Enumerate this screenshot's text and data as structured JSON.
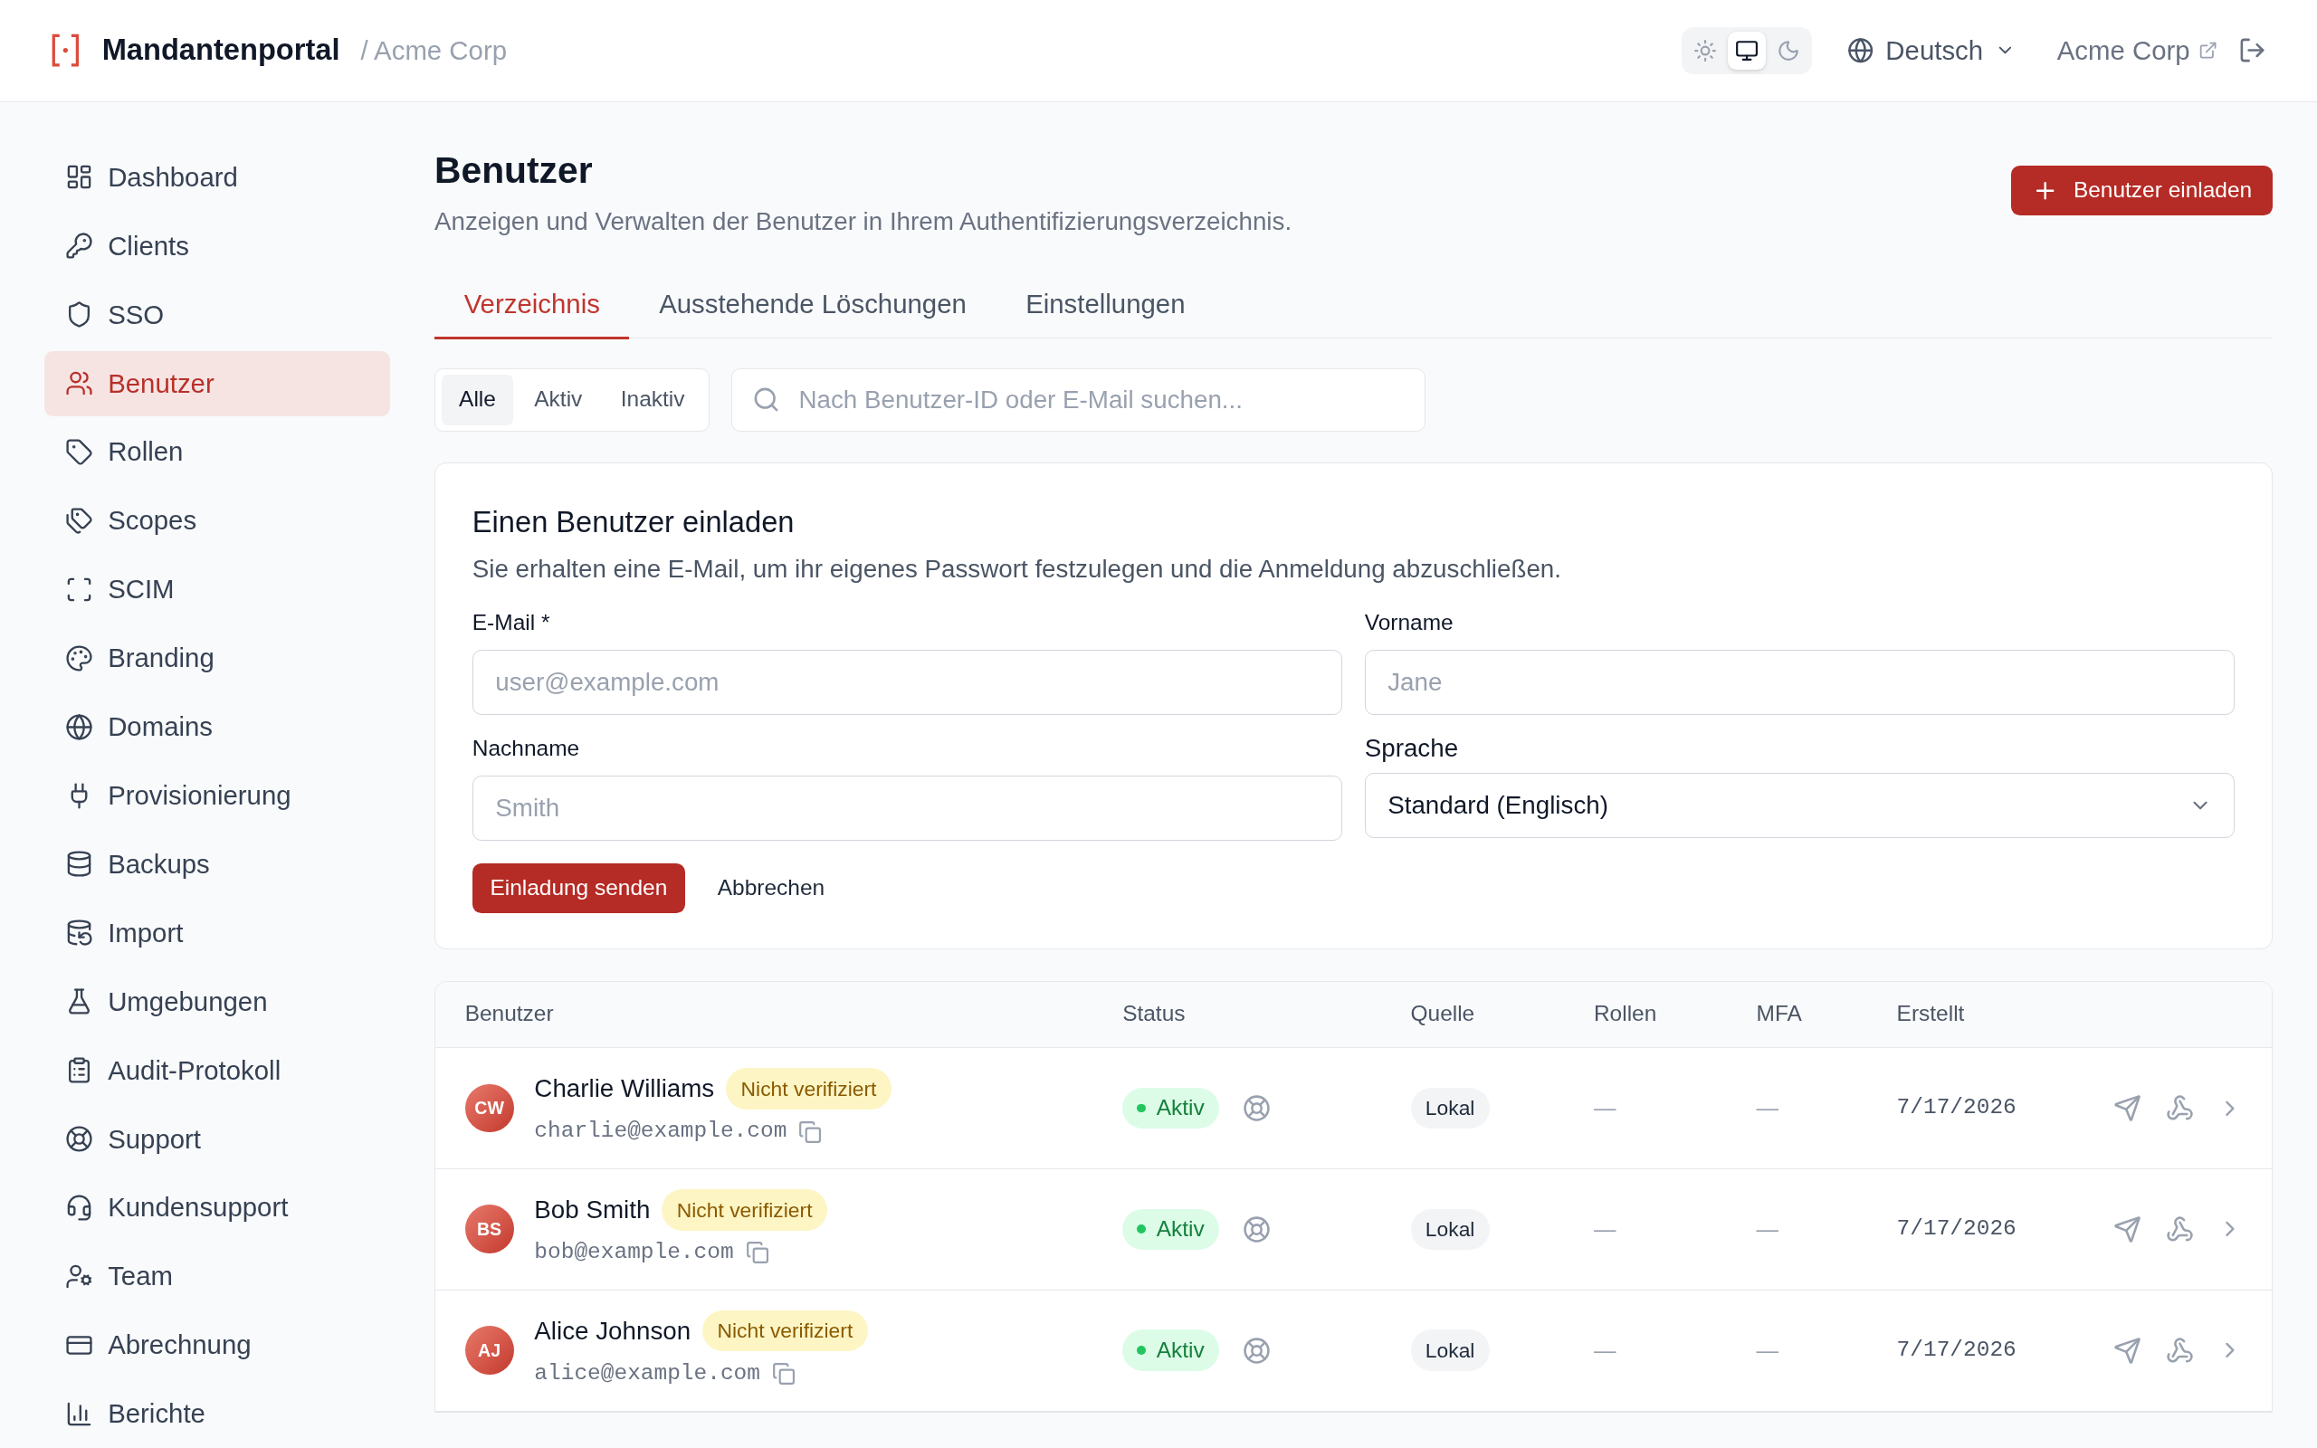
{
  "header": {
    "brand": "Mandantenportal",
    "breadcrumb": "/ Acme Corp",
    "theme_options": [
      {
        "selected": false
      },
      {
        "selected": true
      },
      {
        "selected": false
      }
    ],
    "language": "Deutsch",
    "tenant_link": "Acme Corp"
  },
  "sidebar": {
    "items": [
      {
        "label": "Dashboard",
        "selected": false
      },
      {
        "label": "Clients",
        "selected": false
      },
      {
        "label": "SSO",
        "selected": false
      },
      {
        "label": "Benutzer",
        "selected": true
      },
      {
        "label": "Rollen",
        "selected": false
      },
      {
        "label": "Scopes",
        "selected": false
      },
      {
        "label": "SCIM",
        "selected": false
      },
      {
        "label": "Branding",
        "selected": false
      },
      {
        "label": "Domains",
        "selected": false
      },
      {
        "label": "Provisionierung",
        "selected": false
      },
      {
        "label": "Backups",
        "selected": false
      },
      {
        "label": "Import",
        "selected": false
      },
      {
        "label": "Umgebungen",
        "selected": false
      },
      {
        "label": "Audit-Protokoll",
        "selected": false
      },
      {
        "label": "Support",
        "selected": false
      },
      {
        "label": "Kundensupport",
        "selected": false
      },
      {
        "label": "Team",
        "selected": false
      },
      {
        "label": "Abrechnung",
        "selected": false
      },
      {
        "label": "Berichte",
        "selected": false
      }
    ]
  },
  "page": {
    "title": "Benutzer",
    "subtitle": "Anzeigen und Verwalten der Benutzer in Ihrem Authentifizierungsverzeichnis.",
    "invite_button": "Benutzer einladen",
    "tabs": [
      {
        "label": "Verzeichnis",
        "selected": true
      },
      {
        "label": "Ausstehende Löschungen",
        "selected": false
      },
      {
        "label": "Einstellungen",
        "selected": false
      }
    ],
    "filters": [
      {
        "label": "Alle",
        "selected": true
      },
      {
        "label": "Aktiv",
        "selected": false
      },
      {
        "label": "Inaktiv",
        "selected": false
      }
    ],
    "search": {
      "placeholder": "Nach Benutzer-ID oder E-Mail suchen..."
    }
  },
  "invite_form": {
    "title": "Einen Benutzer einladen",
    "description": "Sie erhalten eine E-Mail, um ihr eigenes Passwort festzulegen und die Anmeldung abzuschließen.",
    "fields": [
      {
        "kind": "input",
        "label": "E-Mail *",
        "placeholder": "user@example.com"
      },
      {
        "kind": "input",
        "label": "Vorname",
        "placeholder": "Jane"
      },
      {
        "kind": "input",
        "label": "Nachname",
        "placeholder": "Smith"
      },
      {
        "kind": "select",
        "label": "Sprache",
        "value": "Standard (Englisch)"
      }
    ],
    "submit": "Einladung senden",
    "cancel": "Abbrechen"
  },
  "table": {
    "columns": [
      "Benutzer",
      "Status",
      "Quelle",
      "Rollen",
      "MFA",
      "Erstellt"
    ],
    "rows": [
      {
        "initials": "CW",
        "name": "Charlie Williams",
        "badge": "Nicht verifiziert",
        "email": "charlie@example.com",
        "status": "Aktiv",
        "source": "Lokal",
        "roles": "—",
        "mfa": "—",
        "created": "7/17/2026"
      },
      {
        "initials": "BS",
        "name": "Bob Smith",
        "badge": "Nicht verifiziert",
        "email": "bob@example.com",
        "status": "Aktiv",
        "source": "Lokal",
        "roles": "—",
        "mfa": "—",
        "created": "7/17/2026"
      },
      {
        "initials": "AJ",
        "name": "Alice Johnson",
        "badge": "Nicht verifiziert",
        "email": "alice@example.com",
        "status": "Aktiv",
        "source": "Lokal",
        "roles": "—",
        "mfa": "—",
        "created": "7/17/2026"
      }
    ]
  }
}
